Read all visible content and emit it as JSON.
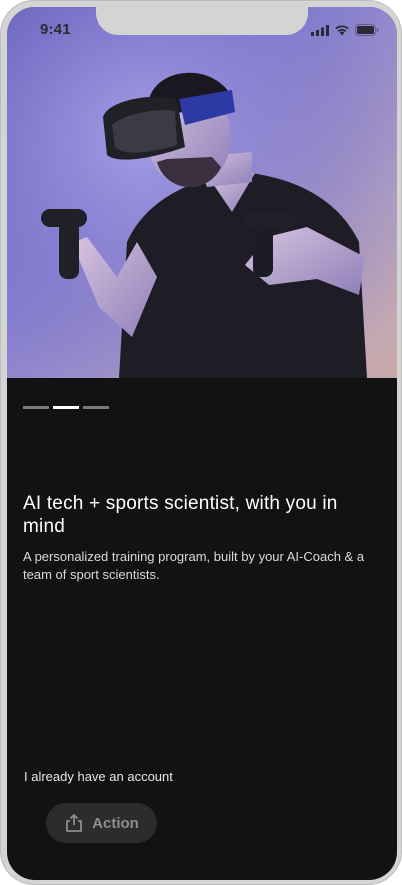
{
  "status_bar": {
    "time": "9:41"
  },
  "onboarding": {
    "pager": {
      "total": 3,
      "active_index": 1
    },
    "headline": "AI tech + sports scientist, with you in mind",
    "subtitle": "A personalized training program, built by your AI-Coach & a team of sport scientists.",
    "login_link": "I already have an account",
    "action_button": {
      "label": "Action",
      "icon": "share-icon"
    }
  },
  "colors": {
    "background": "#121212",
    "text_primary": "#ffffff",
    "text_secondary": "#d9d9d9",
    "pager_active": "#ffffff",
    "pager_inactive": "#7a7a7a",
    "button_bg": "#2c2c2c",
    "button_text": "#8c8c8c"
  }
}
